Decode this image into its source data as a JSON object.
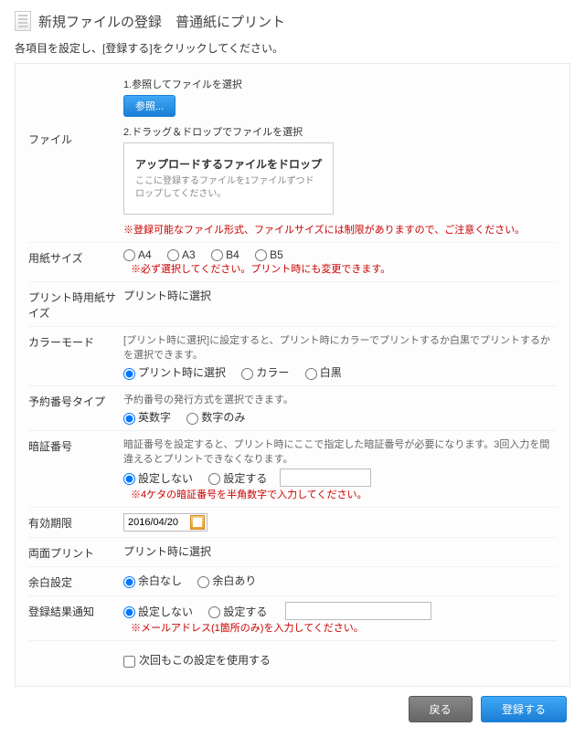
{
  "header": {
    "title": "新規ファイルの登録　普通紙にプリント"
  },
  "intro": "各項目を設定し、[登録する]をクリックしてください。",
  "file": {
    "label": "ファイル",
    "step1": "1.参照してファイルを選択",
    "browse": "参照...",
    "step2": "2.ドラッグ＆ドロップでファイルを選択",
    "dz_title": "アップロードするファイルをドロップ",
    "dz_sub": "ここに登録するファイルを1ファイルずつドロップしてください。",
    "note": "※登録可能なファイル形式、ファイルサイズには制限がありますので、ご注意ください。"
  },
  "paper": {
    "label": "用紙サイズ",
    "opts": [
      "A4",
      "A3",
      "B4",
      "B5"
    ],
    "note": "※必ず選択してください。プリント時にも変更できます。"
  },
  "print_paper": {
    "label": "プリント時用紙サイズ",
    "value": "プリント時に選択"
  },
  "color": {
    "label": "カラーモード",
    "desc": "[プリント時に選択]に設定すると、プリント時にカラーでプリントするか白黒でプリントするかを選択できます。",
    "opts": [
      "プリント時に選択",
      "カラー",
      "白黒"
    ]
  },
  "reserve": {
    "label": "予約番号タイプ",
    "desc": "予約番号の発行方式を選択できます。",
    "opts": [
      "英数字",
      "数字のみ"
    ]
  },
  "pin": {
    "label": "暗証番号",
    "desc": "暗証番号を設定すると、プリント時にここで指定した暗証番号が必要になります。3回入力を間違えるとプリントできなくなります。",
    "opts": [
      "設定しない",
      "設定する"
    ],
    "note": "※4ケタの暗証番号を半角数字で入力してください。"
  },
  "expire": {
    "label": "有効期限",
    "value": "2016/04/20"
  },
  "duplex": {
    "label": "両面プリント",
    "value": "プリント時に選択"
  },
  "margin": {
    "label": "余白設定",
    "opts": [
      "余白なし",
      "余白あり"
    ]
  },
  "notify": {
    "label": "登録結果通知",
    "opts": [
      "設定しない",
      "設定する"
    ],
    "note": "※メールアドレス(1箇所のみ)を入力してください。"
  },
  "remember": "次回もこの設定を使用する",
  "buttons": {
    "back": "戻る",
    "submit": "登録する"
  }
}
